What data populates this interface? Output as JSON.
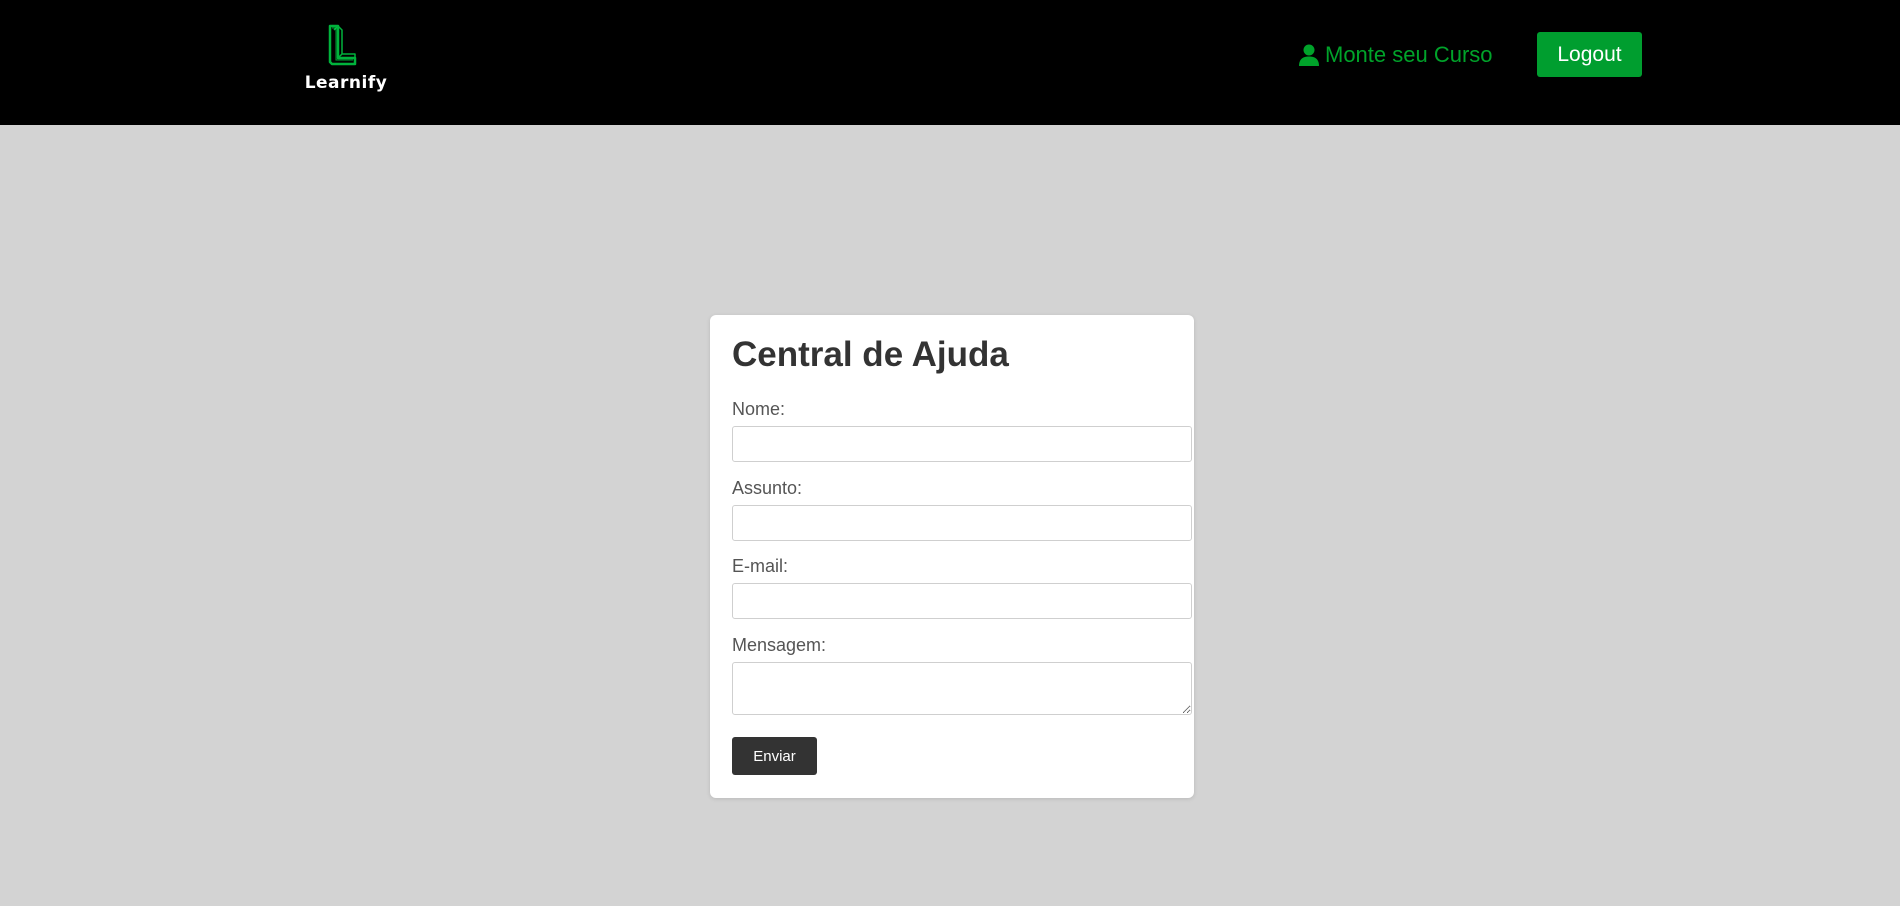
{
  "header": {
    "brand_name": "Learnify",
    "nav_link_label": "Monte seu Curso",
    "logout_label": "Logout",
    "accent_color": "#009e2f"
  },
  "help_form": {
    "title": "Central de Ajuda",
    "fields": [
      {
        "label": "Nome:",
        "value": "",
        "type": "text"
      },
      {
        "label": "Assunto:",
        "value": "",
        "type": "text"
      },
      {
        "label": "E-mail:",
        "value": "",
        "type": "email"
      },
      {
        "label": "Mensagem:",
        "value": "",
        "type": "textarea"
      }
    ],
    "submit_label": "Enviar"
  },
  "icons": {
    "logo": "learnify-logo-icon",
    "nav_link": "user-icon"
  }
}
